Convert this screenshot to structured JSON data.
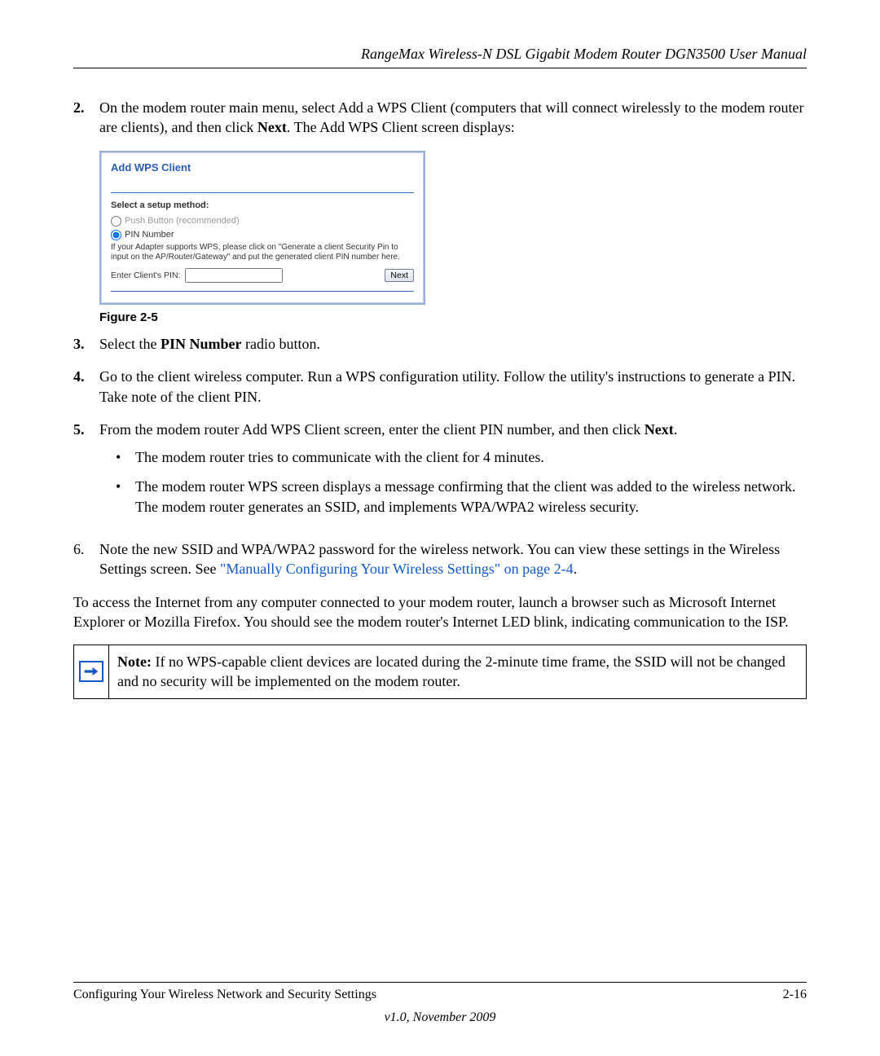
{
  "header": {
    "title": "RangeMax Wireless-N DSL Gigabit Modem Router DGN3500 User Manual"
  },
  "steps": {
    "s2": {
      "num": "2.",
      "part1": "On the modem router main menu, select Add a WPS Client (computers that will connect wirelessly to the modem router are clients), and then click ",
      "bold1": "Next",
      "part2": ". The Add WPS Client screen displays:"
    },
    "s3": {
      "num": "3.",
      "part1": "Select the ",
      "bold1": "PIN Number",
      "part2": " radio button."
    },
    "s4": {
      "num": "4.",
      "text": "Go to the client wireless computer. Run a WPS configuration utility. Follow the utility's instructions to generate a PIN. Take note of the client PIN."
    },
    "s5": {
      "num": "5.",
      "part1": "From the modem router Add WPS Client screen, enter the client PIN number, and then click ",
      "bold1": "Next",
      "part2": "."
    },
    "s5_b1": "The modem router tries to communicate with the client for 4 minutes.",
    "s5_b2": "The modem router WPS screen displays a message confirming that the client was added to the wireless network. The modem router generates an SSID, and implements WPA/WPA2 wireless security.",
    "s6": {
      "num": "6.",
      "part1": "Note the new SSID and WPA/WPA2 password for the wireless network. You can view these settings in the Wireless Settings screen. See ",
      "link": "\"Manually Configuring Your Wireless Settings\" on page 2-4",
      "part2": "."
    }
  },
  "paragraph": "To access the Internet from any computer connected to your modem router, launch a browser such as Microsoft Internet Explorer or Mozilla Firefox. You should see the modem router's Internet LED blink, indicating communication to the ISP.",
  "note": {
    "label": "Note:",
    "text": " If no WPS-capable client devices are located during the 2-minute time frame, the SSID will not be changed and no security will be implemented on the modem router."
  },
  "figure": {
    "caption": "Figure 2-5"
  },
  "wps": {
    "title": "Add WPS Client",
    "select_label": "Select a setup method:",
    "opt_push": "Push Button (recommended)",
    "opt_pin": "PIN Number",
    "hint": "If your Adapter supports WPS, please click on \"Generate a client Security Pin to input on the AP/Router/Gateway\" and put the generated client PIN number here.",
    "pin_label": "Enter Client's PIN:",
    "next": "Next"
  },
  "footer": {
    "left": "Configuring Your Wireless Network and Security Settings",
    "right": "2-16",
    "version": "v1.0, November 2009"
  }
}
